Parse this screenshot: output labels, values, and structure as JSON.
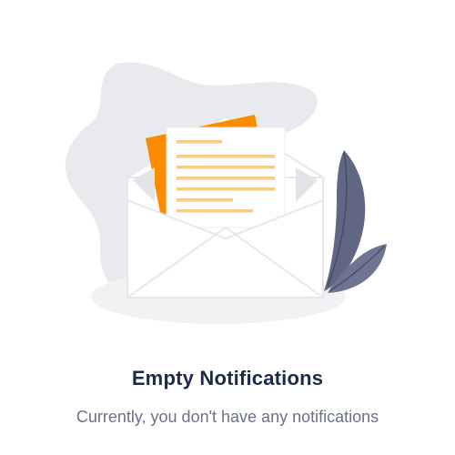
{
  "empty_state": {
    "title": "Empty Notifications",
    "subtitle": "Currently, you don't have any notifications",
    "illustration": "open-envelope-with-letter-icon"
  },
  "colors": {
    "title": "#1f2a4a",
    "subtitle": "#6b7189",
    "blob": "#e9eaee",
    "accent_orange": "#fb8c00",
    "letter_lines": "#f9c98a",
    "leaf": "#5f6782",
    "envelope_stroke": "#e6e7ec"
  }
}
